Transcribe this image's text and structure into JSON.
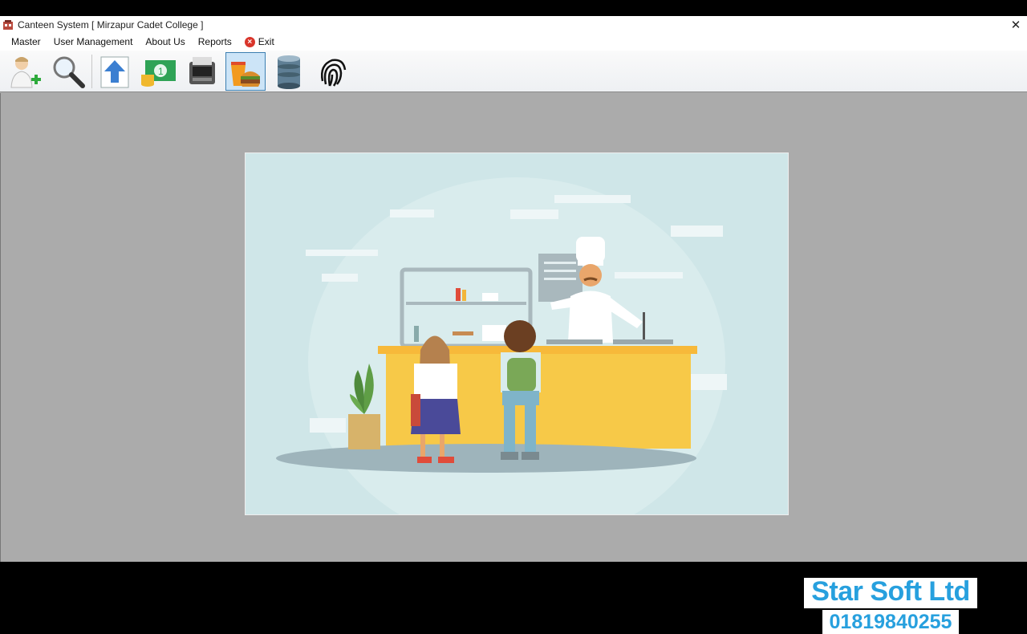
{
  "window": {
    "title": "Canteen System [ Mirzapur Cadet College ]",
    "close_glyph": "✕"
  },
  "menu": {
    "items": [
      {
        "label": "Master"
      },
      {
        "label": "User Management"
      },
      {
        "label": "About Us"
      },
      {
        "label": "Reports"
      },
      {
        "label": "Exit",
        "icon": "exit-icon"
      }
    ]
  },
  "toolbar": {
    "buttons": [
      {
        "name": "add-user-icon",
        "active": false
      },
      {
        "name": "search-icon",
        "active": false
      },
      {
        "name": "upload-icon",
        "active": false
      },
      {
        "name": "money-icon",
        "active": false
      },
      {
        "name": "pos-terminal-icon",
        "active": false
      },
      {
        "name": "food-icon",
        "active": true
      },
      {
        "name": "database-icon",
        "active": false
      },
      {
        "name": "fingerprint-icon",
        "active": false
      }
    ]
  },
  "watermark": {
    "company": "Star Soft Ltd",
    "phone": "01819840255",
    "color": "#27a0de"
  },
  "colors": {
    "workspace": "#ababab",
    "picture_bg": "#cfe6e8",
    "counter": "#f7c948"
  }
}
